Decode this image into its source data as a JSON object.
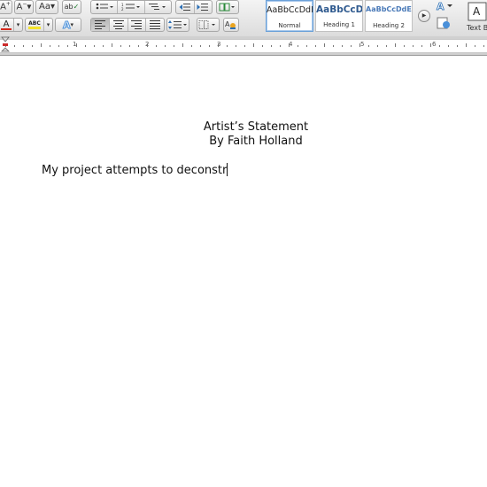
{
  "toolbar": {
    "styles": [
      {
        "sample": "AaBbCcDdEe",
        "name": "Normal"
      },
      {
        "sample": "AaBbCcDc",
        "name": "Heading 1"
      },
      {
        "sample": "AaBbCcDdEe",
        "name": "Heading 2"
      }
    ],
    "text_box_label": "Text B",
    "icons": {
      "grow_font": "font-size-increase-icon",
      "shrink_font": "font-size-decrease-icon",
      "change_case": "change-case-icon",
      "spelling": "spelling-icon",
      "bullets": "bulleted-list-icon",
      "numbering": "numbered-list-icon",
      "multilevel": "multilevel-list-icon",
      "decrease_indent": "decrease-indent-icon",
      "increase_indent": "increase-indent-icon",
      "columns": "columns-icon",
      "font_color": "font-color-icon",
      "highlight": "highlight-icon",
      "text_effects": "text-effects-icon",
      "align_left": "align-left-icon",
      "align_center": "align-center-icon",
      "align_right": "align-right-icon",
      "justify": "justify-icon",
      "line_spacing": "line-spacing-icon",
      "borders": "borders-icon",
      "show_formatting": "show-formatting-icon",
      "gallery_next": "gallery-next-icon",
      "styles_pane": "styles-pane-icon",
      "text_box": "text-box-icon"
    },
    "colors": {
      "font_color": "#d52b1e",
      "highlight": "#f5e32a",
      "text_effects": "#4a90d9",
      "heading": "#2f5a8f"
    }
  },
  "ruler": {
    "numbers": [
      "1",
      "2",
      "3",
      "4",
      "5",
      "6"
    ]
  },
  "document": {
    "title": "Artist’s Statement",
    "byline": "By Faith Holland",
    "body": "My project attempts to deconstr"
  }
}
